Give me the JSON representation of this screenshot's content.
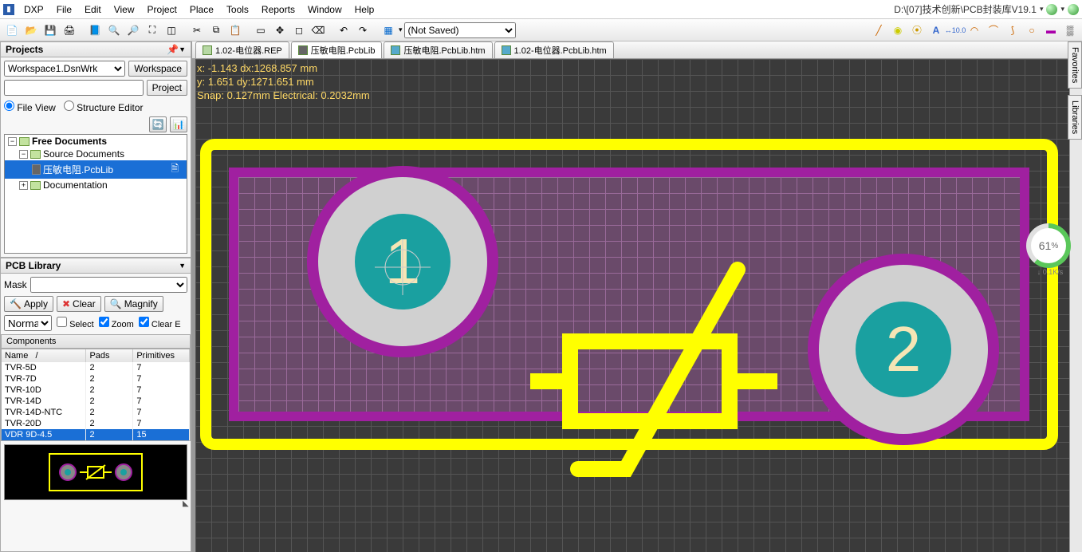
{
  "app": {
    "dxp": "DXP",
    "logo": "▮"
  },
  "menus": [
    "File",
    "Edit",
    "View",
    "Project",
    "Place",
    "Tools",
    "Reports",
    "Window",
    "Help"
  ],
  "titlePath": "D:\\[07]技术创新\\PCB封装库V19.1",
  "toolbar": {
    "notSaved": "(Not Saved)"
  },
  "projects": {
    "title": "Projects",
    "workspaceFile": "Workspace1.DsnWrk",
    "workspaceBtn": "Workspace",
    "projectBtn": "Project",
    "fileView": "File View",
    "structureEditor": "Structure Editor",
    "tree": {
      "root": "Free Documents",
      "source": "Source Documents",
      "doc": "压敏电阻.PcbLib",
      "docu": "Documentation"
    }
  },
  "pcblib": {
    "title": "PCB Library",
    "maskLabel": "Mask",
    "apply": "Apply",
    "clear": "Clear",
    "magnify": "Magnify",
    "normal": "Normal",
    "selectChk": "Select",
    "zoomChk": "Zoom",
    "clearEChk": "Clear E",
    "componentsHeader": "Components",
    "cols": {
      "name": "Name",
      "pads": "Pads",
      "primitives": "Primitives"
    },
    "rows": [
      {
        "name": "TVR-5D",
        "pads": "2",
        "prim": "7"
      },
      {
        "name": "TVR-7D",
        "pads": "2",
        "prim": "7"
      },
      {
        "name": "TVR-10D",
        "pads": "2",
        "prim": "7"
      },
      {
        "name": "TVR-14D",
        "pads": "2",
        "prim": "7"
      },
      {
        "name": "TVR-14D-NTC",
        "pads": "2",
        "prim": "7"
      },
      {
        "name": "TVR-20D",
        "pads": "2",
        "prim": "7"
      },
      {
        "name": "VDR 9D-4.5",
        "pads": "2",
        "prim": "15"
      }
    ]
  },
  "doctabs": [
    {
      "label": "1.02-电位器.REP",
      "active": false
    },
    {
      "label": "压敏电阻.PcbLib",
      "active": true
    },
    {
      "label": "压敏电阻.PcbLib.htm",
      "active": false
    },
    {
      "label": "1.02-电位器.PcbLib.htm",
      "active": false
    }
  ],
  "coords": {
    "l1": "x: -1.143   dx:1268.857  mm",
    "l2": "y:  1.651   dy:1271.651  mm",
    "l3": "Snap: 0.127mm Electrical: 0.2032mm"
  },
  "pads": {
    "p1": "1",
    "p2": "2"
  },
  "rightTabs": [
    "Favorites",
    "Libraries"
  ],
  "speed": {
    "pct": "61",
    "unit": "%",
    "rate": "↓ 0.1K/s"
  }
}
